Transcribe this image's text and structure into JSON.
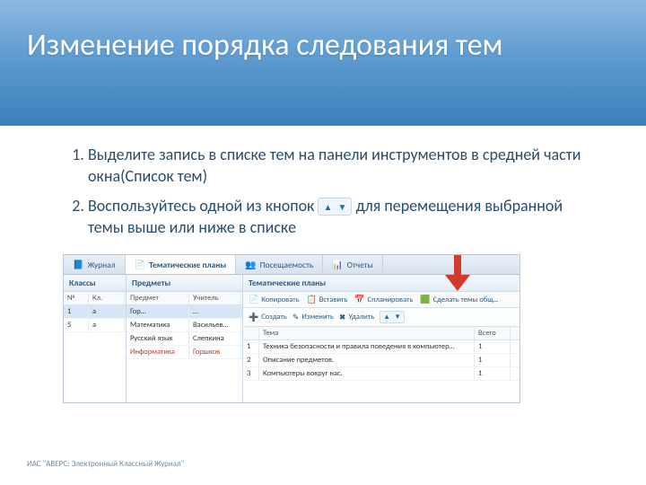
{
  "slide": {
    "title": "Изменение порядка следования тем",
    "footer": "ИАС \"АВЕРС: Электронный Классный Журнал\""
  },
  "steps": {
    "items": [
      {
        "text": "Выделите запись в списке тем на панели инструментов в средней части окна(Список тем)"
      },
      {
        "before": "Воспользуйтесь одной из кнопок",
        "after": "для перемещения выбранной темы выше или ниже в списке"
      }
    ]
  },
  "tabs": [
    {
      "icon": "📘",
      "label": "Журнал"
    },
    {
      "icon": "📄",
      "label": "Тематические планы",
      "active": true
    },
    {
      "icon": "👥",
      "label": "Посещаемость"
    },
    {
      "icon": "📊",
      "label": "Отчеты"
    }
  ],
  "paneLeft": {
    "title": "Классы",
    "cols": [
      "№",
      "Кл."
    ],
    "rows": [
      {
        "c": [
          "1",
          "а"
        ],
        "sel": true
      },
      {
        "c": [
          "5",
          "а"
        ]
      }
    ]
  },
  "paneMid": {
    "title": "Предметы",
    "cols": [
      "Предмет",
      "Учитель"
    ],
    "rows": [
      {
        "c": [
          "Гор…",
          "…"
        ],
        "sel": true
      },
      {
        "c": [
          "Математика",
          "Васильев…"
        ]
      },
      {
        "c": [
          "Русский язык",
          "Слепкина"
        ]
      },
      {
        "c": [
          "Информатика",
          "Горшков"
        ],
        "hl": true
      }
    ]
  },
  "paneRight": {
    "title": "Тематические планы",
    "toolbar1": [
      {
        "icon": "📄",
        "label": "Копировать"
      },
      {
        "icon": "📋",
        "label": "Вставить"
      },
      {
        "icon": "📅",
        "label": "Спланировать"
      },
      {
        "icon": "🟩",
        "label": "Сделать темы общ…"
      }
    ],
    "toolbar2": [
      {
        "icon": "➕",
        "label": "Создать"
      },
      {
        "icon": "✎",
        "label": "Изменить"
      },
      {
        "icon": "✖",
        "label": "Удалить"
      }
    ],
    "cols": [
      "",
      "Тема",
      "Всего"
    ],
    "rows": [
      {
        "c": [
          "1",
          "Техника безопасности и правила поведения в компьютер…",
          "1"
        ]
      },
      {
        "c": [
          "2",
          "Описание предметов.",
          "1"
        ]
      },
      {
        "c": [
          "3",
          "Компьютеры вокруг нас.",
          "1"
        ]
      }
    ]
  }
}
